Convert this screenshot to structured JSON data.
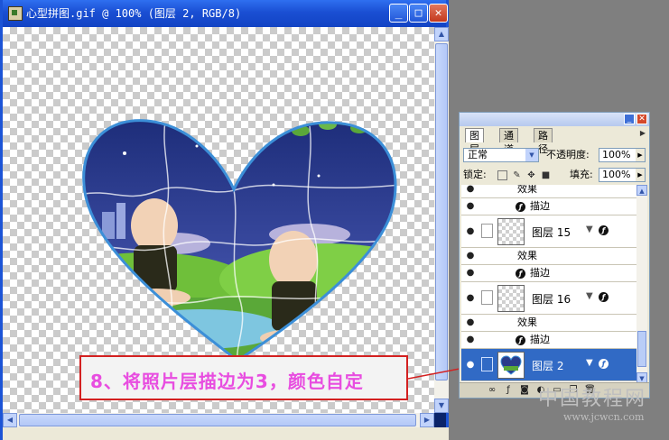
{
  "document": {
    "title": "心型拼图.gif @ 100% (图层 2, RGB/8)",
    "controls": {
      "minimize": "_",
      "maximize": "□",
      "close": "✕"
    }
  },
  "annotation": {
    "text": "8、将照片层描边为3，颜色自定"
  },
  "layers_panel": {
    "tabs": [
      "图层",
      "通道",
      "路径"
    ],
    "active_tab": 0,
    "blend_mode": "正常",
    "opacity_label": "不透明度:",
    "opacity_value": "100%",
    "lock_label": "锁定:",
    "fill_label": "填充:",
    "fill_value": "100%",
    "rows": [
      {
        "kind": "effects",
        "label": "效果"
      },
      {
        "kind": "effect",
        "label": "描边"
      },
      {
        "kind": "layer",
        "name": "图层 15",
        "selected": false
      },
      {
        "kind": "effects",
        "label": "效果"
      },
      {
        "kind": "effect",
        "label": "描边"
      },
      {
        "kind": "layer",
        "name": "图层 16",
        "selected": false
      },
      {
        "kind": "effects",
        "label": "效果"
      },
      {
        "kind": "effect",
        "label": "描边"
      },
      {
        "kind": "layer",
        "name": "图层 2",
        "selected": true
      }
    ]
  },
  "watermark": {
    "cn": "中国教程网",
    "url": "www.jcwcn.com"
  },
  "colors": {
    "title_bar": "#1a4fd3",
    "heart_outline": "#3c8fd8",
    "annotation_border": "#d32020",
    "annotation_text": "#e84de0",
    "selected_row": "#316ac5"
  }
}
